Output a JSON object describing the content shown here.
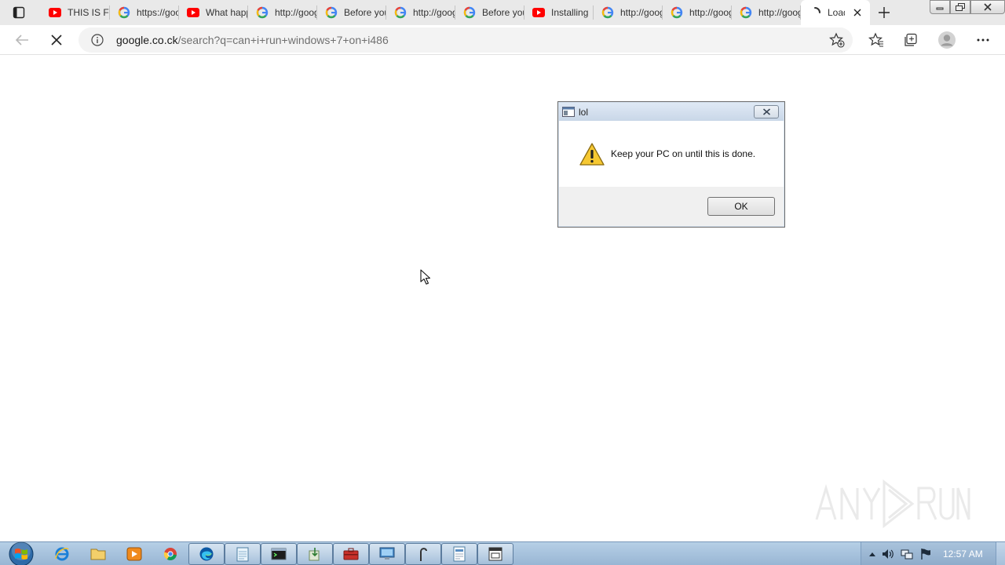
{
  "browser": {
    "tabs": [
      {
        "icon": "youtube-icon",
        "title": "THIS IS FLAT EARTH"
      },
      {
        "icon": "google-icon",
        "title": "https://google.com"
      },
      {
        "icon": "youtube-icon",
        "title": "What happens"
      },
      {
        "icon": "google-icon",
        "title": "http://google.com"
      },
      {
        "icon": "google-icon",
        "title": "Before you continue"
      },
      {
        "icon": "google-icon",
        "title": "http://google.com"
      },
      {
        "icon": "google-icon",
        "title": "Before you continue"
      },
      {
        "icon": "youtube-icon",
        "title": "Installing"
      },
      {
        "icon": "google-icon",
        "title": "http://google.com"
      },
      {
        "icon": "google-icon",
        "title": "http://google.com"
      },
      {
        "icon": "google-icon",
        "title": "http://google.com"
      },
      {
        "icon": "loading-icon",
        "title": "Loading",
        "active": true
      }
    ],
    "address": {
      "host": "google.co.ck",
      "path": "/search?q=can+i+run+windows+7+on+i486"
    }
  },
  "dialog": {
    "title": "lol",
    "message": "Keep your PC on until this is done.",
    "ok_label": "OK"
  },
  "taskbar": {
    "clock": "12:57 AM"
  },
  "colors": {
    "youtube_red": "#ff0000",
    "edge_blue": "#0c59a4",
    "taskbar": "#a9c4de"
  }
}
